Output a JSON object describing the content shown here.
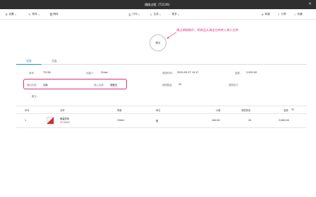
{
  "window": {
    "title": "调拨过程（T2136）"
  },
  "toolbar": {
    "settings": "设置",
    "edit": "修改",
    "delete": "删除",
    "print": "打印",
    "generate": "生成",
    "more": "更多",
    "new": "新建",
    "share": "分享",
    "favorite": "收藏"
  },
  "workflow": {
    "button_label": "确定"
  },
  "annotation": {
    "text": "通过调拨操作，将商品从调出仓库转入调入仓库"
  },
  "tabs": [
    {
      "label": "信息"
    },
    {
      "label": "日志"
    }
  ],
  "info": {
    "doc_no_label": "单号:",
    "doc_no": "T2136",
    "creator_label": "创建人:",
    "creator": "Chloe",
    "time_label": "调拨时间:",
    "time": "2020-05-27 10:17",
    "amount_label": "金额:",
    "amount": "2,000.00",
    "from_wh_label": "调出仓库:",
    "from_wh": "仓库",
    "to_wh_label": "调入仓库:",
    "to_wh": "调拨仓",
    "qty_label": "调拨数量:",
    "qty": "20",
    "exec_label": "调拨执行:",
    "remark_label": "备注:"
  },
  "table": {
    "headers": [
      "序号",
      "名称",
      "规格",
      "单位",
      "价格",
      "调拨数量",
      "金额"
    ],
    "rows": [
      {
        "no": "1",
        "name": "瓶装饮料",
        "code": "CIC0003",
        "spec": "250ml",
        "unit": "瓶",
        "price": "100.00",
        "qty": "20",
        "amount": "2,000.00"
      }
    ]
  },
  "colors": {
    "accent": "#1f8fe0",
    "highlight": "#d6337f",
    "titlebar": "#2f2f30"
  }
}
